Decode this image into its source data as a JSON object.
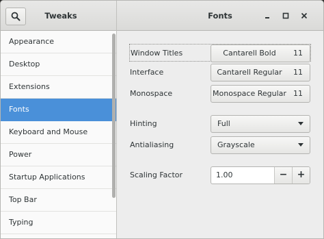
{
  "header": {
    "left_title": "Tweaks",
    "title": "Fonts",
    "search_icon": "search-icon",
    "minimize_icon": "minimize-icon",
    "maximize_icon": "maximize-icon",
    "close_icon": "close-icon"
  },
  "sidebar": {
    "items": [
      {
        "label": "Appearance"
      },
      {
        "label": "Desktop"
      },
      {
        "label": "Extensions"
      },
      {
        "label": "Fonts",
        "selected": true
      },
      {
        "label": "Keyboard and Mouse"
      },
      {
        "label": "Power"
      },
      {
        "label": "Startup Applications"
      },
      {
        "label": "Top Bar"
      },
      {
        "label": "Typing"
      }
    ]
  },
  "fonts": {
    "window_titles": {
      "label": "Window Titles",
      "font": "Cantarell Bold",
      "size": "11"
    },
    "interface": {
      "label": "Interface",
      "font": "Cantarell Regular",
      "size": "11"
    },
    "monospace": {
      "label": "Monospace",
      "font": "Monospace Regular",
      "size": "11"
    },
    "hinting": {
      "label": "Hinting",
      "value": "Full"
    },
    "antialiasing": {
      "label": "Antialiasing",
      "value": "Grayscale"
    },
    "scaling": {
      "label": "Scaling Factor",
      "value": "1.00",
      "decrement": "−",
      "increment": "+"
    }
  },
  "colors": {
    "accent": "#4a90d9",
    "sidebar_bg": "#fafafa",
    "window_bg": "#ededed"
  }
}
